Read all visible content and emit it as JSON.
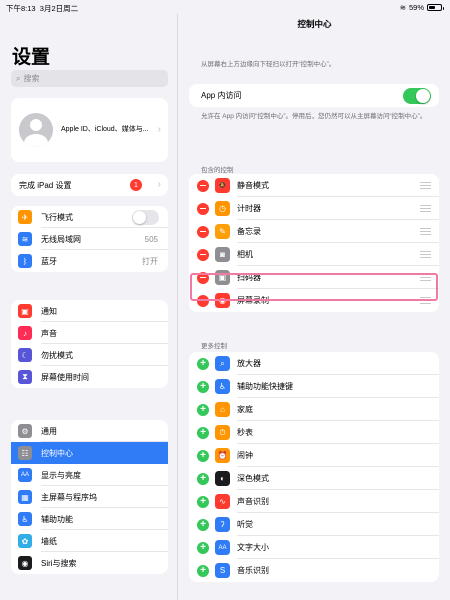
{
  "status": {
    "time": "下午8:13",
    "date": "3月2日周二",
    "battery": "59%",
    "battery_level": 0.59
  },
  "sidebar": {
    "title": "设置",
    "search_placeholder": "搜索",
    "profile_text": "Apple ID、iCloud、媒体与...",
    "ipad_setup": {
      "label": "完成 iPad 设置",
      "badge": "1"
    },
    "group1": [
      {
        "label": "飞行模式",
        "icon": "airplane-icon",
        "color": "#ff9500",
        "glyph": "✈",
        "control": "toggle-off"
      },
      {
        "label": "无线局域网",
        "icon": "wifi-icon",
        "color": "#2f7cf6",
        "glyph": "≋",
        "value": "505"
      },
      {
        "label": "蓝牙",
        "icon": "bluetooth-icon",
        "color": "#2f7cf6",
        "glyph": "ᛒ",
        "value": "打开"
      }
    ],
    "group2": [
      {
        "label": "通知",
        "icon": "notification-icon",
        "color": "#ff3b30",
        "glyph": "▣"
      },
      {
        "label": "声音",
        "icon": "sound-icon",
        "color": "#ff2d55",
        "glyph": "♪"
      },
      {
        "label": "勿扰模式",
        "icon": "moon-icon",
        "color": "#5856d6",
        "glyph": "☾"
      },
      {
        "label": "屏幕使用时间",
        "icon": "hourglass-icon",
        "color": "#5856d6",
        "glyph": "⧗"
      }
    ],
    "group3": [
      {
        "label": "通用",
        "icon": "gear-icon",
        "color": "#8e8e93",
        "glyph": "⚙"
      },
      {
        "label": "控制中心",
        "icon": "switches-icon",
        "color": "#8e8e93",
        "glyph": "☷",
        "active": true
      },
      {
        "label": "显示与亮度",
        "icon": "display-icon",
        "color": "#2f7cf6",
        "glyph": "AA"
      },
      {
        "label": "主屏幕与程序坞",
        "icon": "home-grid-icon",
        "color": "#2f7cf6",
        "glyph": "▦"
      },
      {
        "label": "辅助功能",
        "icon": "accessibility-icon",
        "color": "#2f7cf6",
        "glyph": "♿"
      },
      {
        "label": "墙纸",
        "icon": "wallpaper-icon",
        "color": "#32ade6",
        "glyph": "✿"
      },
      {
        "label": "Siri与搜索",
        "icon": "siri-icon",
        "color": "#1c1c1e",
        "glyph": "◉"
      }
    ]
  },
  "main": {
    "title": "控制中心",
    "intro": "从屏幕右上方边缘向下轻扫以打开“控制中心”。",
    "app_access_label": "App 内访问",
    "app_access_desc": "允许在 App 内访问“控制中心”。停用后，您仍然可以从主屏幕访问“控制中心”。",
    "included_header": "包含的控制",
    "included": [
      {
        "label": "静音模式",
        "icon": "bell-icon",
        "color": "#ff3b30",
        "glyph": "🔕"
      },
      {
        "label": "计时器",
        "icon": "timer-icon",
        "color": "#ff9500",
        "glyph": "◷"
      },
      {
        "label": "备忘录",
        "icon": "notes-icon",
        "color": "#ff9f0a",
        "glyph": "✎"
      },
      {
        "label": "相机",
        "icon": "camera-icon",
        "color": "#8e8e93",
        "glyph": "◙"
      },
      {
        "label": "扫码器",
        "icon": "qr-scanner-icon",
        "color": "#8e8e93",
        "glyph": "▣"
      },
      {
        "label": "屏幕录制",
        "icon": "record-icon",
        "color": "#ff3b30",
        "glyph": "◉"
      }
    ],
    "more_header": "更多控制",
    "more": [
      {
        "label": "放大器",
        "icon": "magnifier-icon",
        "color": "#2f7cf6",
        "glyph": "⌕"
      },
      {
        "label": "辅助功能快捷键",
        "icon": "accessibility-icon",
        "color": "#2f7cf6",
        "glyph": "♿"
      },
      {
        "label": "家庭",
        "icon": "home-icon",
        "color": "#ff9500",
        "glyph": "⌂"
      },
      {
        "label": "秒表",
        "icon": "stopwatch-icon",
        "color": "#ff9500",
        "glyph": "⏱"
      },
      {
        "label": "闹钟",
        "icon": "alarm-icon",
        "color": "#ff9500",
        "glyph": "⏰"
      },
      {
        "label": "深色模式",
        "icon": "dark-mode-icon",
        "color": "#1c1c1e",
        "glyph": "◐"
      },
      {
        "label": "声音识别",
        "icon": "sound-recognition-icon",
        "color": "#ff3b30",
        "glyph": "∿"
      },
      {
        "label": "听觉",
        "icon": "ear-icon",
        "color": "#2f7cf6",
        "glyph": "ʔ"
      },
      {
        "label": "文字大小",
        "icon": "text-size-icon",
        "color": "#2f7cf6",
        "glyph": "AA"
      },
      {
        "label": "音乐识别",
        "icon": "shazam-icon",
        "color": "#2f7cf6",
        "glyph": "S"
      }
    ]
  }
}
